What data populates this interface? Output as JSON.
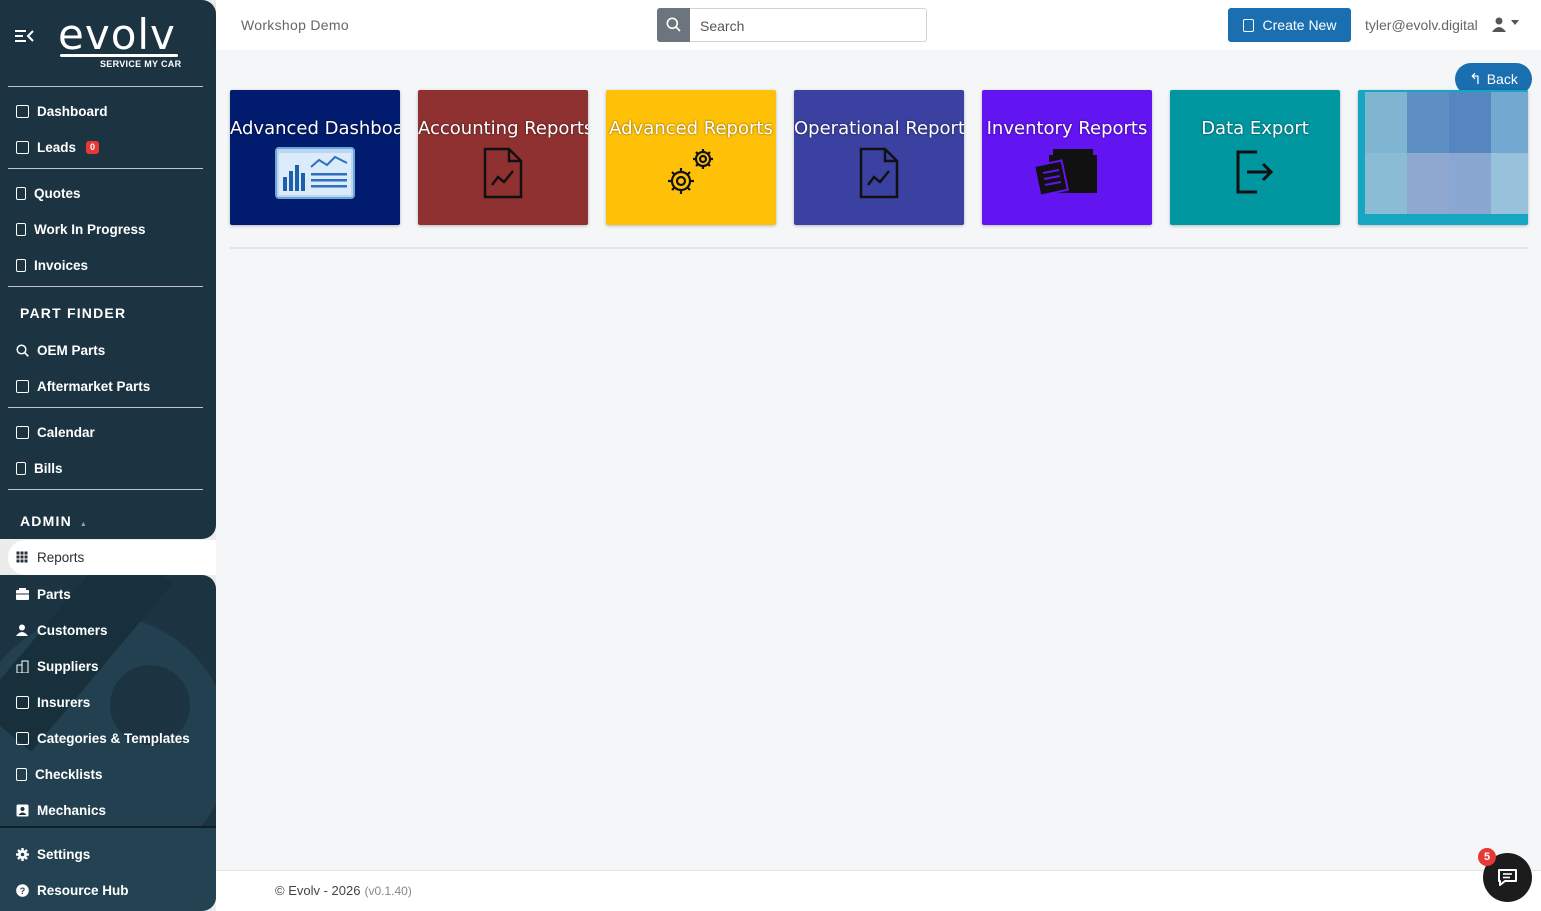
{
  "app": {
    "logo_text": "evolv",
    "logo_tagline": "SERVICE MY CAR"
  },
  "header": {
    "workshop": "Workshop Demo",
    "search_placeholder": "Search",
    "create_label": "Create New",
    "user_email": "tyler@evolv.digital"
  },
  "sidebar": {
    "group1": [
      {
        "label": "Dashboard"
      },
      {
        "label": "Leads",
        "badge": "0"
      }
    ],
    "group2": [
      {
        "label": "Quotes"
      },
      {
        "label": "Work In Progress"
      },
      {
        "label": "Invoices"
      }
    ],
    "part_finder_heading": "PART FINDER",
    "part_finder": [
      {
        "label": "OEM Parts"
      },
      {
        "label": "Aftermarket Parts"
      }
    ],
    "group4": [
      {
        "label": "Calendar"
      },
      {
        "label": "Bills"
      }
    ],
    "admin_heading": "ADMIN",
    "admin_active": "Reports",
    "admin": [
      {
        "label": "Parts"
      },
      {
        "label": "Customers"
      },
      {
        "label": "Suppliers"
      },
      {
        "label": "Insurers"
      },
      {
        "label": "Categories & Templates"
      },
      {
        "label": "Checklists"
      },
      {
        "label": "Mechanics"
      }
    ],
    "bottom": [
      {
        "label": "Settings"
      },
      {
        "label": "Resource Hub"
      }
    ]
  },
  "main": {
    "back_label": "Back",
    "tiles": [
      {
        "label": "Advanced Dashboard",
        "color": "#011b6e",
        "icon": "dashboard-chart-icon"
      },
      {
        "label": "Accounting Reports",
        "color": "#8f3131",
        "icon": "report-file-icon"
      },
      {
        "label": "Advanced Reports",
        "color": "#ffc107",
        "icon": "gears-icon"
      },
      {
        "label": "Operational Reports",
        "color": "#3b41a1",
        "icon": "report-file-icon"
      },
      {
        "label": "Inventory Reports",
        "color": "#6214f1",
        "icon": "inventory-box-icon"
      },
      {
        "label": "Data Export",
        "color": "#0097a0",
        "icon": "export-icon"
      },
      {
        "label": "",
        "color": "#17a6c1",
        "icon": "blurred-image"
      }
    ]
  },
  "footer": {
    "copyright": "© Evolv - 2026",
    "version": "(v0.1.40)"
  },
  "chat": {
    "badge": "5"
  },
  "colors": {
    "sidebar": "#1c3441",
    "primary": "#1a6fb0",
    "badge": "#e53935"
  }
}
